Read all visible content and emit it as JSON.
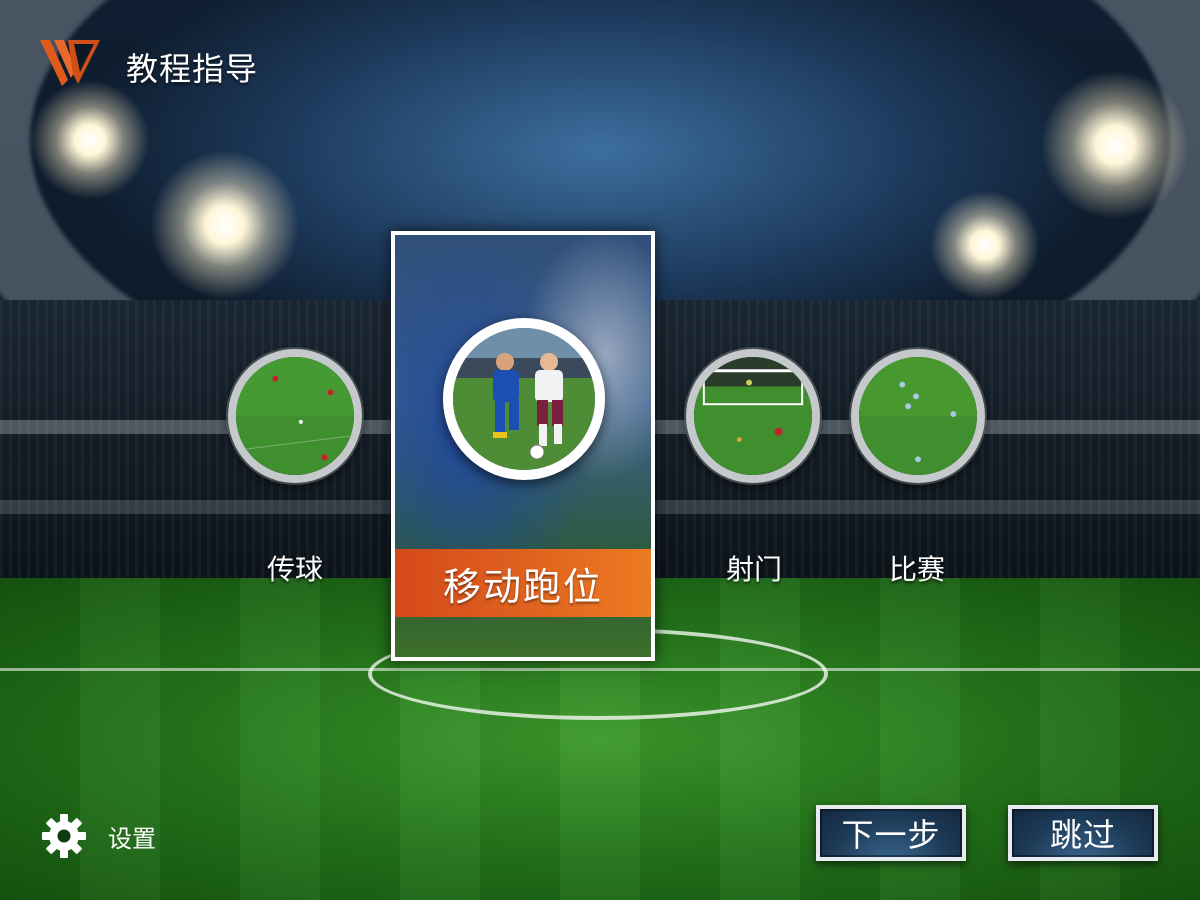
{
  "header": {
    "title": "教程指导",
    "logo_icon": "brand-v-logo"
  },
  "tutorials": {
    "selected": {
      "label": "移动跑位",
      "icon": "players-running-image"
    },
    "items": [
      {
        "label": "传球",
        "icon": "passing-image"
      },
      {
        "label": "射门",
        "icon": "shooting-image"
      },
      {
        "label": "比赛",
        "icon": "match-image"
      }
    ]
  },
  "footer": {
    "settings_label": "设置",
    "settings_icon": "gear-icon",
    "next_label": "下一步",
    "skip_label": "跳过"
  },
  "colors": {
    "accent": "#e0641f",
    "button_bg": "#1d3a57",
    "button_border": "#e8ecf0"
  }
}
